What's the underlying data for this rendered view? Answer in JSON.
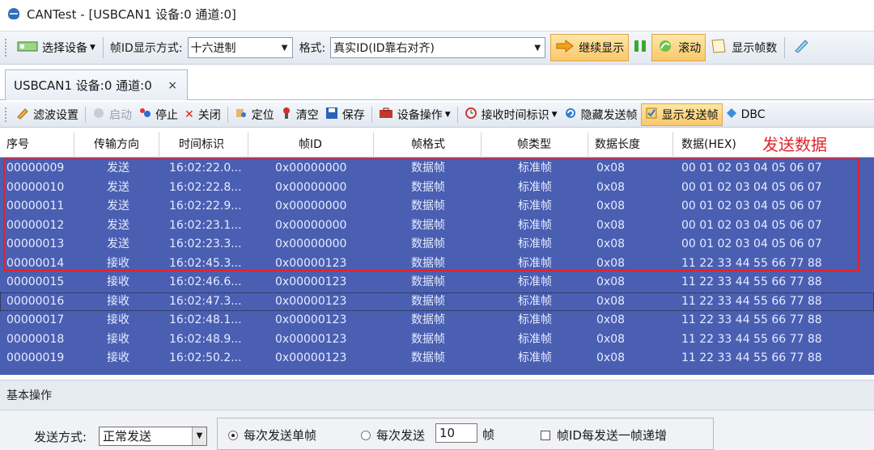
{
  "window": {
    "title": "CANTest  - [USBCAN1 设备:0 通道:0]"
  },
  "toolbar": {
    "select_device": "选择设备",
    "id_display_label": "帧ID显示方式:",
    "id_display_value": "十六进制",
    "format_label": "格式:",
    "format_value": "真实ID(ID靠右对齐)",
    "continue_display": "继续显示",
    "scroll": "滚动",
    "show_frame_count": "显示帧数"
  },
  "tab": {
    "label": "USBCAN1 设备:0 通道:0",
    "close": "×"
  },
  "toolbar2": {
    "filter_settings": "滤波设置",
    "start": "启动",
    "stop": "停止",
    "close": "关闭",
    "locate": "定位",
    "clear": "清空",
    "save": "保存",
    "device_ops": "设备操作",
    "rx_timestamp": "接收时间标识",
    "hide_tx_frames": "隐藏发送帧",
    "show_tx_frames": "显示发送帧",
    "dbc": "DBC"
  },
  "grid": {
    "columns": [
      "序号",
      "传输方向",
      "时间标识",
      "帧ID",
      "帧格式",
      "帧类型",
      "数据长度",
      "数据(HEX)"
    ],
    "annotation": "发送数据",
    "rows": [
      [
        "00000009",
        "发送",
        "16:02:22.0...",
        "0x00000000",
        "数据帧",
        "标准帧",
        "0x08",
        "00 01 02 03 04 05 06 07"
      ],
      [
        "00000010",
        "发送",
        "16:02:22.8...",
        "0x00000000",
        "数据帧",
        "标准帧",
        "0x08",
        "00 01 02 03 04 05 06 07"
      ],
      [
        "00000011",
        "发送",
        "16:02:22.9...",
        "0x00000000",
        "数据帧",
        "标准帧",
        "0x08",
        "00 01 02 03 04 05 06 07"
      ],
      [
        "00000012",
        "发送",
        "16:02:23.1...",
        "0x00000000",
        "数据帧",
        "标准帧",
        "0x08",
        "00 01 02 03 04 05 06 07"
      ],
      [
        "00000013",
        "发送",
        "16:02:23.3...",
        "0x00000000",
        "数据帧",
        "标准帧",
        "0x08",
        "00 01 02 03 04 05 06 07"
      ],
      [
        "00000014",
        "接收",
        "16:02:45.3...",
        "0x00000123",
        "数据帧",
        "标准帧",
        "0x08",
        "11 22 33 44 55 66 77 88"
      ],
      [
        "00000015",
        "接收",
        "16:02:46.6...",
        "0x00000123",
        "数据帧",
        "标准帧",
        "0x08",
        "11 22 33 44 55 66 77 88"
      ],
      [
        "00000016",
        "接收",
        "16:02:47.3...",
        "0x00000123",
        "数据帧",
        "标准帧",
        "0x08",
        "11 22 33 44 55 66 77 88"
      ],
      [
        "00000017",
        "接收",
        "16:02:48.1...",
        "0x00000123",
        "数据帧",
        "标准帧",
        "0x08",
        "11 22 33 44 55 66 77 88"
      ],
      [
        "00000018",
        "接收",
        "16:02:48.9...",
        "0x00000123",
        "数据帧",
        "标准帧",
        "0x08",
        "11 22 33 44 55 66 77 88"
      ],
      [
        "00000019",
        "接收",
        "16:02:50.2...",
        "0x00000123",
        "数据帧",
        "标准帧",
        "0x08",
        "11 22 33 44 55 66 77 88"
      ]
    ]
  },
  "panel": {
    "header": "基本操作",
    "send_mode_label": "发送方式:",
    "send_mode_value": "正常发送",
    "radio_single": "每次发送单帧",
    "radio_multi": "每次发送",
    "multi_count": "10",
    "frame_unit": "帧",
    "increment_checkbox": "帧ID每发送一帧递增"
  },
  "colors": {
    "grid_bg": "#4a5fb2",
    "annotation": "#e3222a",
    "highlight_button": "#f9c86a"
  }
}
